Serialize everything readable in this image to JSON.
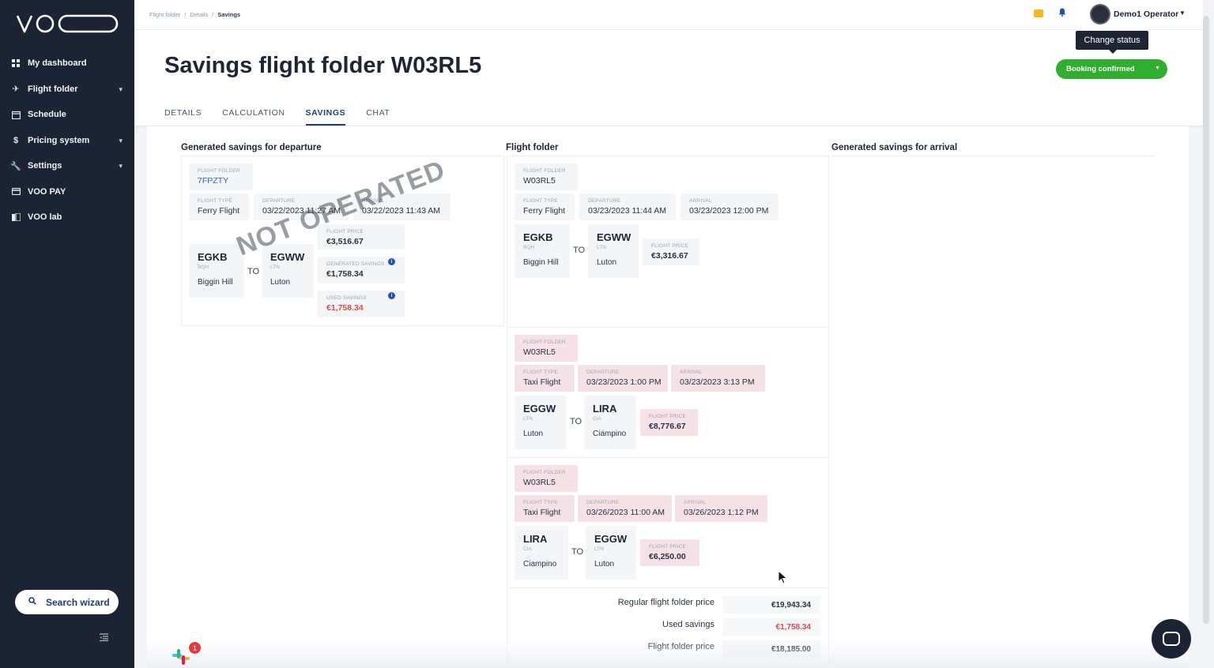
{
  "app": {
    "logo_text": "VOO"
  },
  "sidebar": {
    "items": [
      {
        "label": "My dashboard",
        "icon": "dashboard-icon"
      },
      {
        "label": "Flight folder",
        "icon": "plane-icon"
      },
      {
        "label": "Schedule",
        "icon": "calendar-icon"
      },
      {
        "label": "Pricing system",
        "icon": "dollar-icon"
      },
      {
        "label": "Settings",
        "icon": "wrench-icon"
      },
      {
        "label": "VOO PAY",
        "icon": "card-icon"
      },
      {
        "label": "VOO lab",
        "icon": "lab-icon"
      }
    ],
    "search_wizard": "Search wizard"
  },
  "topbar": {
    "breadcrumb": [
      "Flight folder",
      "Details",
      "Savings"
    ],
    "user_name": "Demo1 Operator"
  },
  "header": {
    "title": "Savings flight folder W03RL5",
    "tooltip": "Change status",
    "status": "Booking confirmed",
    "tabs": [
      "DETAILS",
      "CALCULATION",
      "SAVINGS",
      "CHAT"
    ],
    "active_tab": "SAVINGS"
  },
  "columns": {
    "departure_title": "Generated savings for departure",
    "folder_title": "Flight folder",
    "arrival_title": "Generated savings for arrival"
  },
  "labels": {
    "flight_folder": "FLIGHT FOLDER",
    "flight_type": "FLIGHT TYPE",
    "departure": "DEPARTURE",
    "arrival": "ARRIVAL",
    "flight_price": "FLIGHT PRICE",
    "generated_savings": "GENERATED SAVINGS",
    "used_savings": "USED SAVINGS",
    "to": "TO"
  },
  "departure_card": {
    "folder": "7FPZTY",
    "type": "Ferry Flight",
    "departure": "03/22/2023 11:27 AM",
    "arrival": "03/22/2023 11:43 AM",
    "from": {
      "code": "EGKB",
      "iata": "BQH",
      "city": "Biggin Hill"
    },
    "to": {
      "code": "EGWW",
      "iata": "LTN",
      "city": "Luton"
    },
    "price": "€3,516.67",
    "generated_savings": "€1,758.34",
    "used_savings": "€1,758.34",
    "stamp": "NOT OPERATED"
  },
  "legs": [
    {
      "folder": "W03RL5",
      "type": "Ferry Flight",
      "departure": "03/23/2023 11:44 AM",
      "arrival": "03/23/2023 12:00 PM",
      "from": {
        "code": "EGKB",
        "iata": "BQH",
        "city": "Biggin Hill"
      },
      "to": {
        "code": "EGWW",
        "iata": "LTN",
        "city": "Luton"
      },
      "price": "€3,316.67"
    },
    {
      "folder": "W03RL5",
      "type": "Taxi Flight",
      "departure": "03/23/2023 1:00 PM",
      "arrival": "03/23/2023 3:13 PM",
      "from": {
        "code": "EGGW",
        "iata": "LTN",
        "city": "Luton"
      },
      "to": {
        "code": "LIRA",
        "iata": "CIA",
        "city": "Ciampino"
      },
      "price": "€8,776.67"
    },
    {
      "folder": "W03RL5",
      "type": "Taxi Flight",
      "departure": "03/26/2023 11:00 AM",
      "arrival": "03/26/2023 1:12 PM",
      "from": {
        "code": "LIRA",
        "iata": "CIA",
        "city": "Ciampino"
      },
      "to": {
        "code": "EGGW",
        "iata": "LTN",
        "city": "Luton"
      },
      "price": "€6,250.00"
    }
  ],
  "summary": {
    "regular_label": "Regular flight folder price",
    "regular_value": "€19,943.34",
    "used_label": "Used savings",
    "used_value": "€1,758.34",
    "final_label": "Flight folder price",
    "final_value": "€18,185.00"
  },
  "slack_badge": "1",
  "colors": {
    "accent": "#1d3d86",
    "status_green": "#2fae2f",
    "danger": "#e24a4a",
    "sidebar_bg": "#1c2433",
    "pink_chip": "#f5e2e6"
  }
}
